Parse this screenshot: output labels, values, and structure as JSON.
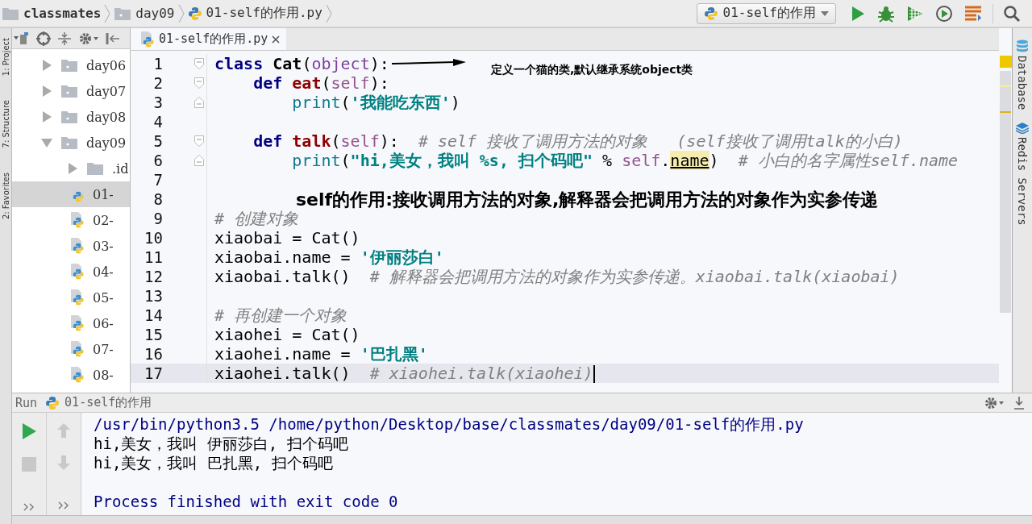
{
  "breadcrumbs": [
    {
      "label": "classmates",
      "kind": "project"
    },
    {
      "label": "day09",
      "kind": "folder"
    },
    {
      "label": "01-self的作用.py",
      "kind": "python"
    }
  ],
  "run_config": {
    "label": "01-self的作用"
  },
  "tool_stripe_left": [
    {
      "label": "1: Project"
    },
    {
      "label": "7: Structure"
    },
    {
      "label": "2: Favorites"
    }
  ],
  "project_tree": [
    {
      "label": "day06",
      "kind": "folder",
      "expanded": false,
      "selected": false
    },
    {
      "label": "day07",
      "kind": "folder",
      "expanded": false,
      "selected": false
    },
    {
      "label": "day08",
      "kind": "folder",
      "expanded": false,
      "selected": false
    },
    {
      "label": "day09",
      "kind": "folder",
      "expanded": true,
      "selected": false,
      "children": [
        {
          "label": ".id",
          "kind": "folder",
          "expanded": false,
          "selected": false
        },
        {
          "label": "01-",
          "kind": "python",
          "selected": true
        },
        {
          "label": "02-",
          "kind": "python",
          "selected": false
        },
        {
          "label": "03-",
          "kind": "python",
          "selected": false
        },
        {
          "label": "04-",
          "kind": "python",
          "selected": false
        },
        {
          "label": "05-",
          "kind": "python",
          "selected": false
        },
        {
          "label": "06-",
          "kind": "python",
          "selected": false
        },
        {
          "label": "07-",
          "kind": "python",
          "selected": false
        },
        {
          "label": "08-",
          "kind": "python",
          "selected": false
        }
      ]
    }
  ],
  "editor": {
    "tab": {
      "label": "01-self的作用.py",
      "selected": true
    },
    "lines": [
      {
        "number": "1",
        "fold_start": true,
        "fold_end": false,
        "current": false,
        "tokens": [
          {
            "kind": "keyword",
            "text": "class "
          },
          {
            "kind": "class",
            "text": "Cat"
          },
          {
            "kind": "plain",
            "text": "("
          },
          {
            "kind": "builtin",
            "text": "object"
          },
          {
            "kind": "plain",
            "text": "):"
          }
        ]
      },
      {
        "number": "2",
        "fold_start": true,
        "fold_end": false,
        "current": false,
        "tokens": [
          {
            "kind": "keyword",
            "text": "    def "
          },
          {
            "kind": "function",
            "text": "eat"
          },
          {
            "kind": "plain",
            "text": "("
          },
          {
            "kind": "self",
            "text": "self"
          },
          {
            "kind": "plain",
            "text": "):"
          }
        ]
      },
      {
        "number": "3",
        "fold_start": false,
        "fold_end": true,
        "current": false,
        "tokens": [
          {
            "kind": "call",
            "text": "        print"
          },
          {
            "kind": "plain",
            "text": "("
          },
          {
            "kind": "string",
            "text": "'我能吃东西'"
          },
          {
            "kind": "plain",
            "text": ")"
          }
        ]
      },
      {
        "number": "4",
        "fold_start": false,
        "fold_end": false,
        "current": false
      },
      {
        "number": "5",
        "fold_start": true,
        "fold_end": false,
        "current": false,
        "tokens": [
          {
            "kind": "keyword",
            "text": "    def "
          },
          {
            "kind": "function",
            "text": "talk"
          },
          {
            "kind": "plain",
            "text": "("
          },
          {
            "kind": "self",
            "text": "self"
          },
          {
            "kind": "plain",
            "text": "):  "
          },
          {
            "kind": "comment",
            "text": "# self 接收了调用方法的对象   (self接收了调用talk的小白)"
          }
        ]
      },
      {
        "number": "6",
        "fold_start": false,
        "fold_end": true,
        "current": false,
        "tokens": [
          {
            "kind": "call",
            "text": "        print"
          },
          {
            "kind": "plain",
            "text": "("
          },
          {
            "kind": "string",
            "text": "\"hi,美女，我叫 %s, 扫个码吧\""
          },
          {
            "kind": "plain",
            "text": " % "
          },
          {
            "kind": "self",
            "text": "self"
          },
          {
            "kind": "plain",
            "text": "."
          },
          {
            "kind": "highlight",
            "text": "name"
          },
          {
            "kind": "plain",
            "text": ")  "
          },
          {
            "kind": "comment",
            "text": "# 小白的名字属性self.name"
          }
        ]
      },
      {
        "number": "7",
        "fold_start": false,
        "fold_end": false,
        "current": false
      },
      {
        "number": "8",
        "fold_start": false,
        "fold_end": false,
        "current": false
      },
      {
        "number": "9",
        "fold_start": false,
        "fold_end": false,
        "current": false,
        "tokens": [
          {
            "kind": "comment",
            "text": "# 创建对象"
          }
        ]
      },
      {
        "number": "10",
        "fold_start": false,
        "fold_end": false,
        "current": false,
        "tokens": [
          {
            "kind": "plain",
            "text": "xiaobai = Cat()"
          }
        ]
      },
      {
        "number": "11",
        "fold_start": false,
        "fold_end": false,
        "current": false,
        "tokens": [
          {
            "kind": "plain",
            "text": "xiaobai.name = "
          },
          {
            "kind": "string",
            "text": "'伊丽莎白'"
          }
        ]
      },
      {
        "number": "12",
        "fold_start": false,
        "fold_end": false,
        "current": false,
        "tokens": [
          {
            "kind": "plain",
            "text": "xiaobai.talk()  "
          },
          {
            "kind": "comment",
            "text": "# 解释器会把调用方法的对象作为实参传递。xiaobai.talk(xiaobai)"
          }
        ]
      },
      {
        "number": "13",
        "fold_start": false,
        "fold_end": false,
        "current": false
      },
      {
        "number": "14",
        "fold_start": false,
        "fold_end": false,
        "current": false,
        "tokens": [
          {
            "kind": "comment",
            "text": "# 再创建一个对象"
          }
        ]
      },
      {
        "number": "15",
        "fold_start": false,
        "fold_end": false,
        "current": false,
        "tokens": [
          {
            "kind": "plain",
            "text": "xiaohei = Cat()"
          }
        ]
      },
      {
        "number": "16",
        "fold_start": false,
        "fold_end": false,
        "current": false,
        "tokens": [
          {
            "kind": "plain",
            "text": "xiaohei.name = "
          },
          {
            "kind": "string",
            "text": "'巴扎黑'"
          }
        ]
      },
      {
        "number": "17",
        "fold_start": false,
        "fold_end": false,
        "current": true,
        "tokens": [
          {
            "kind": "plain",
            "text": "xiaohei.talk()  "
          },
          {
            "kind": "comment",
            "text": "# xiaohei.talk(xiaohei)"
          }
        ]
      }
    ],
    "arrow_note": "定义一个猫的类,默认继承系统object类",
    "banner": "self的作用:接收调用方法的对象,解释器会把调用方法的对象作为实参传递"
  },
  "run_panel": {
    "title": "Run",
    "config": "01-self的作用",
    "output": [
      {
        "kind": "command",
        "text": "/usr/bin/python3.5 /home/python/Desktop/base/classmates/day09/01-self的作用.py"
      },
      {
        "kind": "stdout",
        "text": "hi,美女，我叫 伊丽莎白, 扫个码吧"
      },
      {
        "kind": "stdout",
        "text": "hi,美女，我叫 巴扎黑, 扫个码吧"
      },
      {
        "kind": "exit",
        "text": "Process finished with exit code 0"
      }
    ]
  },
  "tool_stripe_right": [
    {
      "label": "Database",
      "kind": "database"
    },
    {
      "label": "Redis Servers",
      "kind": "redis"
    }
  ]
}
